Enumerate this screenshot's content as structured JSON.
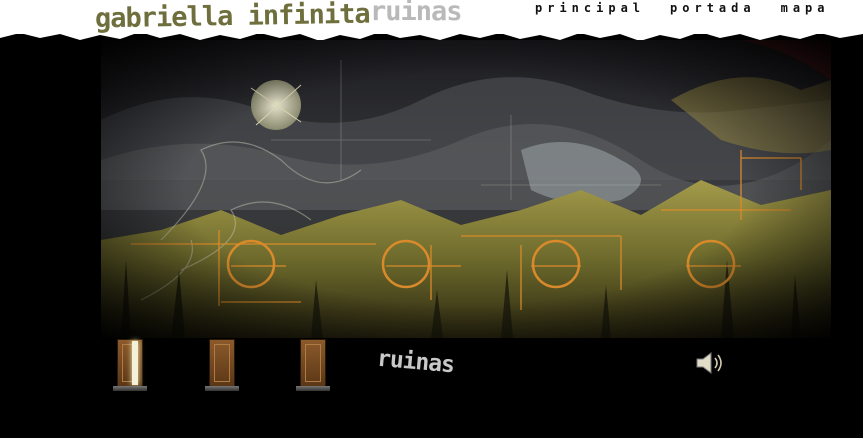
{
  "header": {
    "site_title": "gabriella infinita",
    "section_title": "ruinas",
    "nav": [
      {
        "label": "principal"
      },
      {
        "label": "portada"
      },
      {
        "label": "mapa"
      }
    ]
  },
  "bottom": {
    "doors": [
      {
        "name": "door-1",
        "state": "open"
      },
      {
        "name": "door-2",
        "state": "closed"
      },
      {
        "name": "door-3",
        "state": "closed"
      }
    ],
    "section_label": "ruinas",
    "sound_icon": "speaker-icon"
  },
  "colors": {
    "title": "#6f6f3e",
    "section_top": "#b9b9b9",
    "glyph_orange": "#d98a2a"
  }
}
